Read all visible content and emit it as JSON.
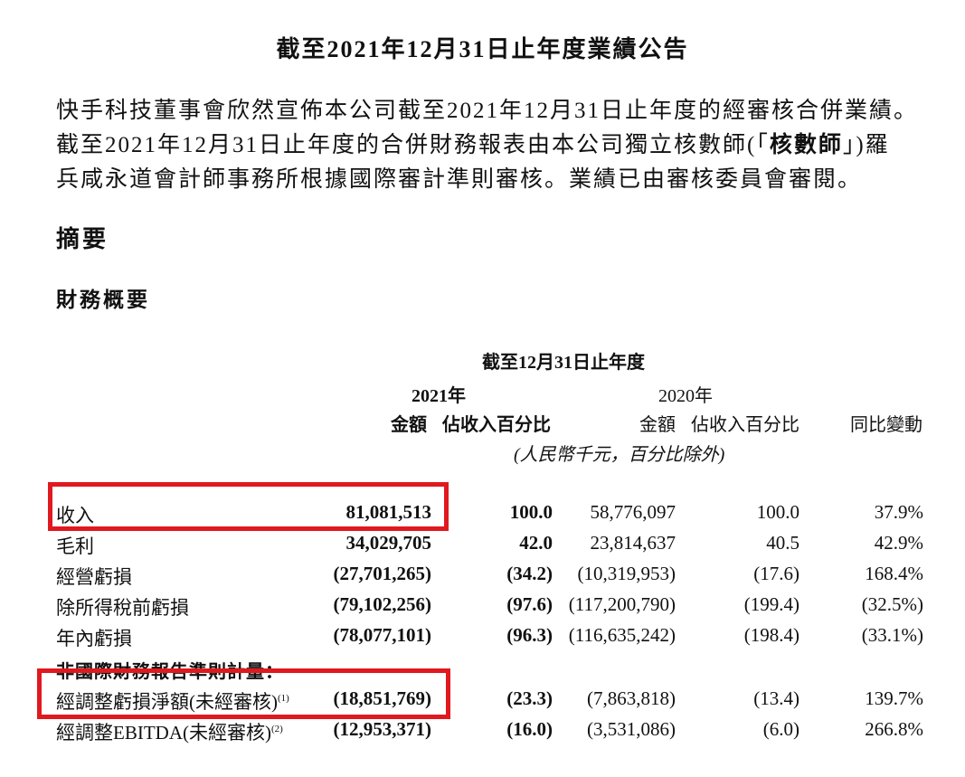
{
  "title": "截至2021年12月31日止年度業績公告",
  "intro": {
    "line1": "快手科技董事會欣然宣佈本公司截至2021年12月31日止年度的經審核合併業績。",
    "line2_pre": "截至2021年12月31日止年度的合併財務報表由本公司獨立核數師(「",
    "line2_bold": "核數師",
    "line2_post": "」)羅",
    "line3": "兵咸永道會計師事務所根據國際審計準則審核。業績已由審核委員會審閱。"
  },
  "heading_summary": "摘要",
  "heading_financial": "財務概要",
  "table": {
    "period_header": "截至12月31日止年度",
    "year_2021": "2021年",
    "year_2020": "2020年",
    "amount_label": "金額",
    "pct_label": "佔收入百分比",
    "yoy_label": "同比變動",
    "unit_note": "(人民幣千元，百分比除外)",
    "rows": [
      {
        "label": "收入",
        "sup": "",
        "amount_2021": "81,081,513",
        "pct_2021": "100.0",
        "amount_2020": "58,776,097",
        "pct_2020": "100.0",
        "yoy": "37.9%"
      },
      {
        "label": "毛利",
        "sup": "",
        "amount_2021": "34,029,705",
        "pct_2021": "42.0",
        "amount_2020": "23,814,637",
        "pct_2020": "40.5",
        "yoy": "42.9%"
      },
      {
        "label": "經營虧損",
        "sup": "",
        "amount_2021": "(27,701,265)",
        "pct_2021": "(34.2)",
        "amount_2020": "(10,319,953)",
        "pct_2020": "(17.6)",
        "yoy": "168.4%"
      },
      {
        "label": "除所得稅前虧損",
        "sup": "",
        "amount_2021": "(79,102,256)",
        "pct_2021": "(97.6)",
        "amount_2020": "(117,200,790)",
        "pct_2020": "(199.4)",
        "yoy": "(32.5%)"
      },
      {
        "label": "年內虧損",
        "sup": "",
        "amount_2021": "(78,077,101)",
        "pct_2021": "(96.3)",
        "amount_2020": "(116,635,242)",
        "pct_2020": "(198.4)",
        "yoy": "(33.1%)"
      }
    ],
    "non_ifrs_header": "非國際財務報告準則計量：",
    "non_ifrs_rows": [
      {
        "label": "經調整虧損淨額(未經審核)",
        "sup": "(1)",
        "amount_2021": "(18,851,769)",
        "pct_2021": "(23.3)",
        "amount_2020": "(7,863,818)",
        "pct_2020": "(13.4)",
        "yoy": "139.7%"
      },
      {
        "label": "經調整EBITDA(未經審核)",
        "sup": "(2)",
        "amount_2021": "(12,953,371)",
        "pct_2021": "(16.0)",
        "amount_2020": "(3,531,086)",
        "pct_2020": "(6.0)",
        "yoy": "266.8%"
      }
    ]
  },
  "highlight_color": "#e0191f"
}
